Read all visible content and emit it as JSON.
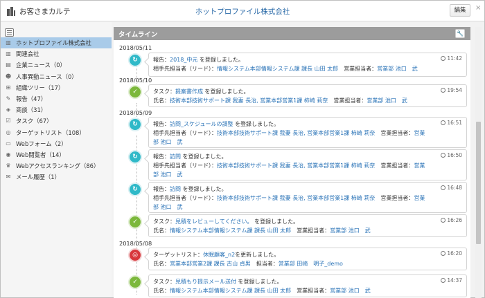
{
  "header": {
    "app_title": "お客さまカルテ",
    "company": "ホットプロファイル株式会社",
    "edit_label": "編集",
    "close_label": "×"
  },
  "sidebar": {
    "items": [
      {
        "label": "ホットプロファイル株式会社",
        "icon": "building-icon",
        "active": true
      },
      {
        "label": "関連会社",
        "icon": "building-icon"
      },
      {
        "label": "企業ニュース（0）",
        "icon": "chart-icon"
      },
      {
        "label": "人事異動ニュース（0）",
        "icon": "people-icon"
      },
      {
        "label": "組織ツリー（17）",
        "icon": "org-tree-icon"
      },
      {
        "label": "報告（47）",
        "icon": "pencil-icon"
      },
      {
        "label": "商談（31）",
        "icon": "handshake-icon"
      },
      {
        "label": "タスク（67）",
        "icon": "check-icon"
      },
      {
        "label": "ターゲットリスト（108）",
        "icon": "target-icon"
      },
      {
        "label": "Webフォーム（2）",
        "icon": "form-icon"
      },
      {
        "label": "Web閲覧者（14）",
        "icon": "globe-icon"
      },
      {
        "label": "Webアクセスランキング（86）",
        "icon": "crown-icon"
      },
      {
        "label": "メール履歴（1）",
        "icon": "mail-icon"
      }
    ]
  },
  "timeline": {
    "title": "タイムライン",
    "dates": [
      "2018/05/11",
      "2018/05/10",
      "2018/05/09",
      "2018/05/08"
    ],
    "entries": [
      {
        "type": "report",
        "time": "11:42",
        "line1": {
          "pre": "報告：",
          "link": "2018_中元",
          "post": " を登録しました。"
        },
        "line2": {
          "pre": "相手先担当者（リード）：",
          "link": "情報システム本部情報システム課 課長 山田 太郎",
          "mid": "　営業担当者：",
          "link2": "営業部 池口　武"
        }
      },
      {
        "type": "task",
        "time": "19:54",
        "line1": {
          "pre": "タスク：",
          "link": "提案書作成",
          "post": " を登録しました。"
        },
        "line2": {
          "pre": "氏名：",
          "link": "技術本部技術サポート課 我妻 長治, 営業本部営業1課 柿崎 莉奈",
          "mid": "　営業担当者：",
          "link2": "営業部 池口　武"
        }
      },
      {
        "type": "report",
        "time": "16:51",
        "line1": {
          "pre": "報告：",
          "link": "訪問_スケジュールの調整",
          "post": " を登録しました。"
        },
        "line2": {
          "pre": "相手先担当者（リード）：",
          "link": "技術本部技術サポート課 我妻 長治, 営業本部営業1課 柿崎 莉奈",
          "mid": "　営業担当者：",
          "link2": "営業部 池口　武"
        }
      },
      {
        "type": "report",
        "time": "16:50",
        "line1": {
          "pre": "報告：",
          "link": "訪問",
          "post": " を登録しました。"
        },
        "line2": {
          "pre": "相手先担当者（リード）：",
          "link": "技術本部技術サポート課 我妻 長治, 営業本部営業1課 柿崎 莉奈",
          "mid": "　営業担当者：",
          "link2": "営業部 池口　武"
        }
      },
      {
        "type": "report",
        "time": "16:48",
        "line1": {
          "pre": "報告：",
          "link": "訪問",
          "post": " を登録しました。"
        },
        "line2": {
          "pre": "相手先担当者（リード）：",
          "link": "技術本部技術サポート課 我妻 長治, 営業本部営業1課 柿崎 莉奈",
          "mid": "　営業担当者：",
          "link2": "営業部 池口　武"
        }
      },
      {
        "type": "task",
        "time": "16:26",
        "line1": {
          "pre": "タスク：",
          "link": "見積をレビューしてください。",
          "post": " を登録しました。"
        },
        "line2": {
          "pre": "氏名：",
          "link": "情報システム本部情報システム課 課長 山田 太郎",
          "mid": "　営業担当者：",
          "link2": "営業部 池口　武"
        }
      },
      {
        "type": "target",
        "time": "16:20",
        "line1": {
          "pre": "ターゲットリスト：",
          "link": "休眠顧客_n2",
          "post": "を更新しました。"
        },
        "line2": {
          "pre": "氏名：",
          "link": "営業本部営業2課 課長 古山 貞男",
          "mid": "　担当者：",
          "link2": "営業部 田崎　明子_demo"
        }
      },
      {
        "type": "task",
        "time": "14:37",
        "line1": {
          "pre": "タスク：",
          "link": "見積もり提示メール送付",
          "post": " を登録しました。"
        },
        "line2": {
          "pre": "氏名：",
          "link": "情報システム本部情報システム課 課長 山田 太郎",
          "mid": "　営業担当者：",
          "link2": "営業部 池口　武"
        }
      }
    ]
  },
  "colors": {
    "report": "#2fb9c8",
    "task": "#7cb83c",
    "target": "#d8373c",
    "link": "#2a73b7",
    "active_item": "#a9cbe9"
  }
}
